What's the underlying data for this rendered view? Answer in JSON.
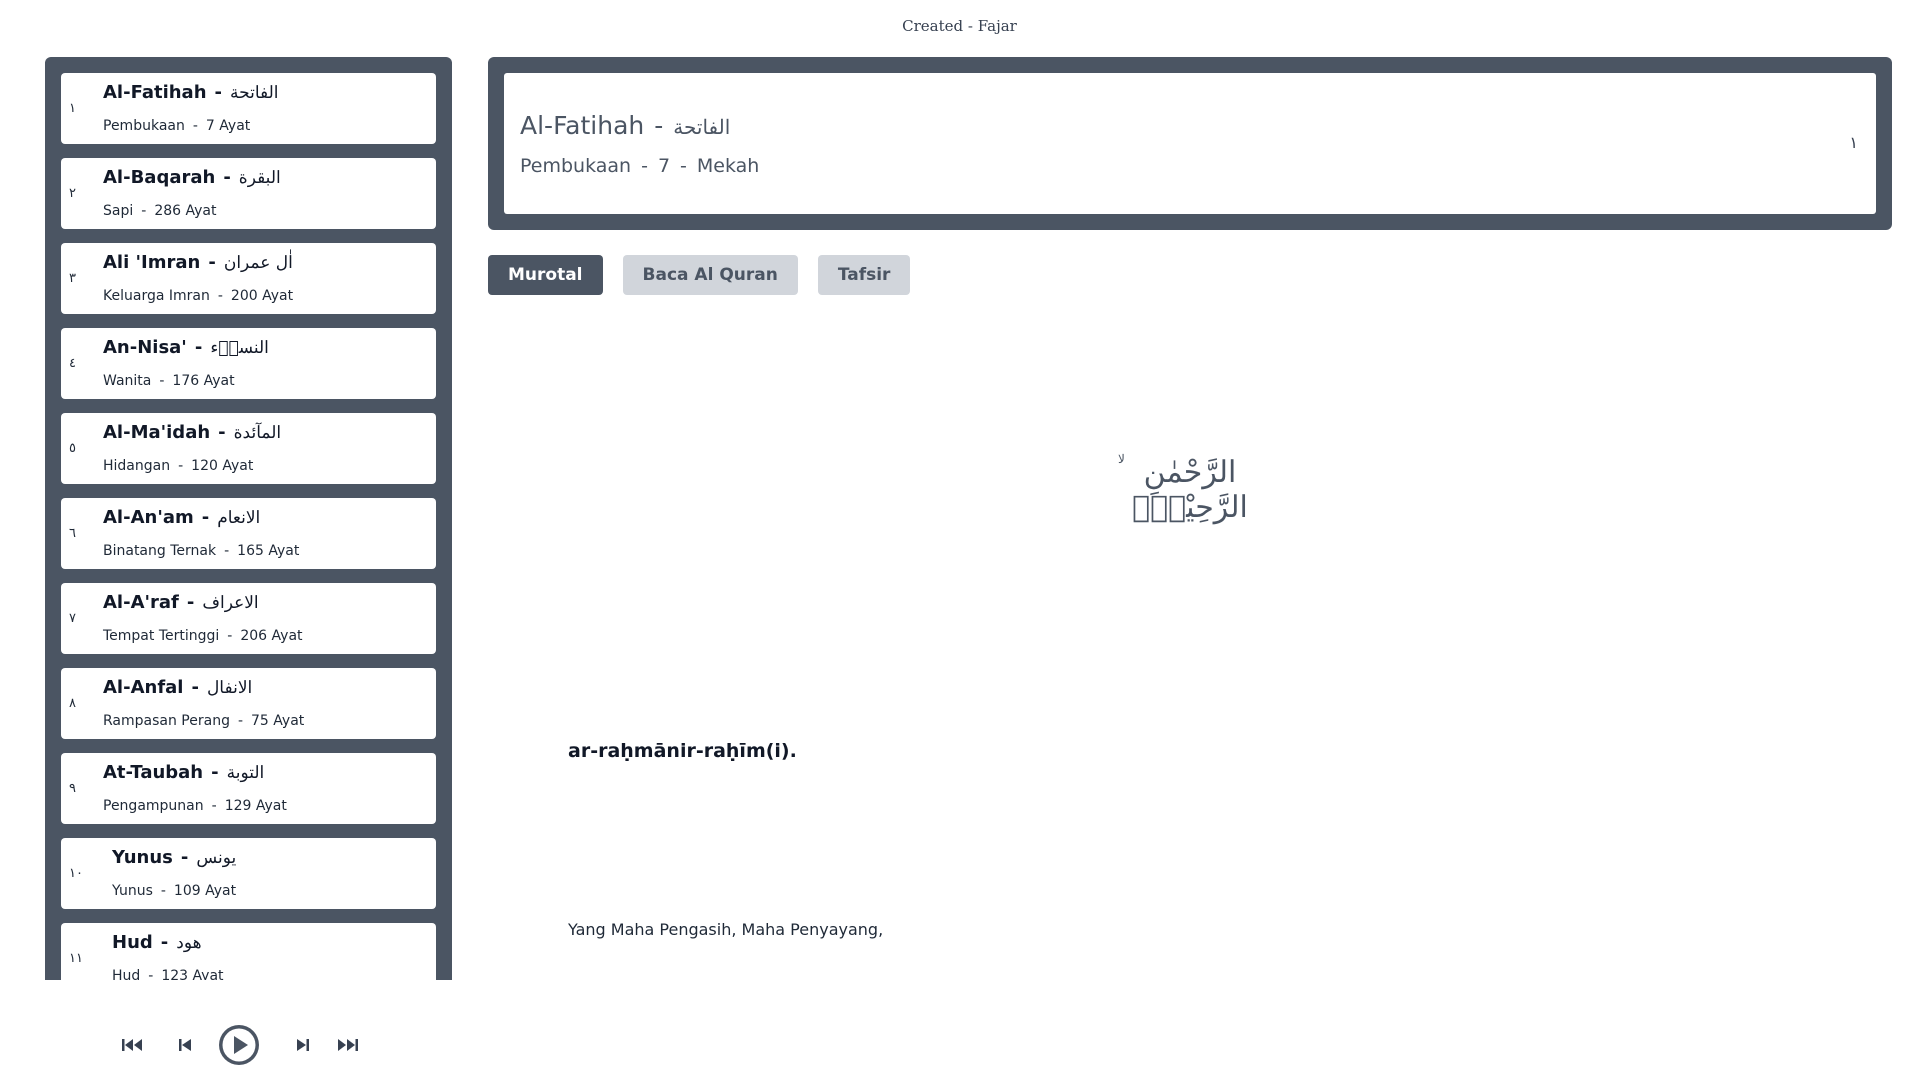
{
  "credit": "Created - Fajar",
  "surahs": [
    {
      "num": "١",
      "latin": "Al-Fatihah",
      "arabic": "الفاتحة",
      "meaning": "Pembukaan",
      "ayat": "7 Ayat"
    },
    {
      "num": "٢",
      "latin": "Al-Baqarah",
      "arabic": "البقرة",
      "meaning": "Sapi",
      "ayat": "286 Ayat"
    },
    {
      "num": "٣",
      "latin": "Ali 'Imran",
      "arabic": "اٰل عمران",
      "meaning": "Keluarga Imran",
      "ayat": "200 Ayat"
    },
    {
      "num": "٤",
      "latin": "An-Nisa'",
      "arabic": "النساۤء",
      "meaning": "Wanita",
      "ayat": "176 Ayat"
    },
    {
      "num": "٥",
      "latin": "Al-Ma'idah",
      "arabic": "المآئدة",
      "meaning": "Hidangan",
      "ayat": "120 Ayat"
    },
    {
      "num": "٦",
      "latin": "Al-An'am",
      "arabic": "الانعام",
      "meaning": "Binatang Ternak",
      "ayat": "165 Ayat"
    },
    {
      "num": "٧",
      "latin": "Al-A'raf",
      "arabic": "الاعراف",
      "meaning": "Tempat Tertinggi",
      "ayat": "206 Ayat"
    },
    {
      "num": "٨",
      "latin": "Al-Anfal",
      "arabic": "الانفال",
      "meaning": "Rampasan Perang",
      "ayat": "75 Ayat"
    },
    {
      "num": "٩",
      "latin": "At-Taubah",
      "arabic": "التوبة",
      "meaning": "Pengampunan",
      "ayat": "129 Ayat"
    },
    {
      "num": "١٠",
      "latin": "Yunus",
      "arabic": "يونس",
      "meaning": "Yunus",
      "ayat": "109 Ayat"
    },
    {
      "num": "١١",
      "latin": "Hud",
      "arabic": "هود",
      "meaning": "Hud",
      "ayat": "123 Ayat"
    }
  ],
  "header": {
    "latin": "Al-Fatihah",
    "arabic": "الفاتحة",
    "meaning": "Pembukaan",
    "ayat_count": "7",
    "place": "Mekah",
    "num": "١"
  },
  "tabs": [
    {
      "label": "Murotal",
      "active": true
    },
    {
      "label": "Baca Al Quran",
      "active": false
    },
    {
      "label": "Tafsir",
      "active": false
    }
  ],
  "ayah": {
    "arabic": "الرَّحْمٰنِ الرَّحِيْمِۙ",
    "waqf": "لا",
    "latin": "ar-raḥmānir-raḥīm(i).",
    "translation": "Yang Maha Pengasih, Maha Penyayang,"
  },
  "player": {
    "icons": [
      "skip-to-start-icon",
      "previous-icon",
      "play-icon",
      "next-icon",
      "skip-to-end-icon"
    ]
  },
  "colors": {
    "frame": "#4b5563",
    "tab_inactive": "#d1d5db"
  }
}
